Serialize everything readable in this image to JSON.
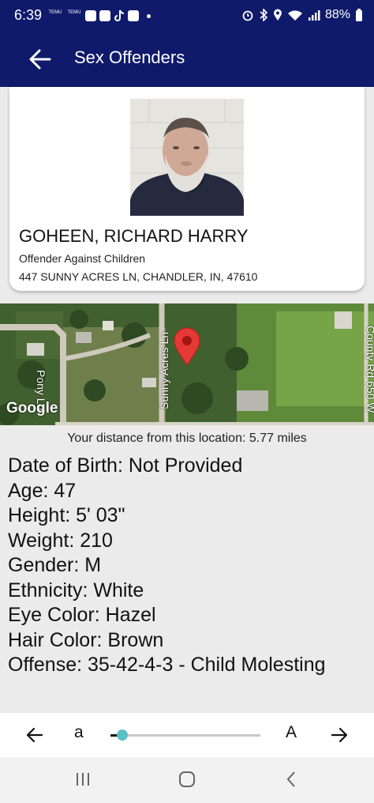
{
  "status_bar": {
    "time": "6:39",
    "battery": "88%",
    "left_icons": [
      "temu-icon",
      "temu-icon",
      "news-icon",
      "news-icon",
      "tiktok-icon",
      "news-icon",
      "dot-icon"
    ],
    "right_icons": [
      "alarm-icon",
      "bluetooth-icon",
      "location-icon",
      "wifi-icon",
      "signal-icon",
      "battery-icon"
    ],
    "notification_labels": {
      "temu": "TEMU"
    }
  },
  "app_bar": {
    "title": "Sex Offenders",
    "back_icon": "arrow-left-icon",
    "background": "#0f1a6b"
  },
  "offender": {
    "name": "GOHEEN, RICHARD HARRY",
    "type": "Offender Against Children",
    "address": "447 SUNNY ACRES LN, CHANDLER, IN, 47610"
  },
  "map": {
    "logo": "Google",
    "roads": {
      "pony": "Pony Ln",
      "sunny": "Sunny Acres Ln",
      "county": "County Rd 650 W"
    },
    "marker": "map-pin-icon"
  },
  "distance_text": "Your distance from this location: 5.77 miles",
  "details": [
    "Date of Birth: Not Provided",
    "Age: 47",
    "Height: 5' 03\"",
    "Weight: 210",
    "Gender: M",
    "Ethnicity: White",
    "Eye Color: Hazel",
    "Hair Color: Brown",
    "Offense: 35-42-4-3 - Child Molesting"
  ],
  "bottom_bar": {
    "prev_icon": "arrow-left-icon",
    "small_label": "a",
    "large_label": "A",
    "next_icon": "arrow-right-icon",
    "text_size_slider_fraction": 0.08,
    "slider_color": "#5bbfc7"
  },
  "nav_bar": {
    "icons": [
      "recent-apps-icon",
      "home-icon",
      "back-icon"
    ]
  }
}
